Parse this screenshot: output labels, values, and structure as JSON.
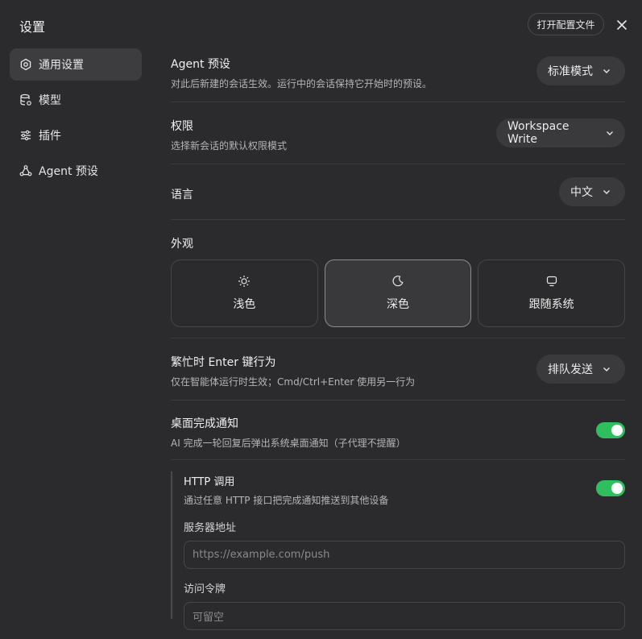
{
  "header": {
    "title": "设置",
    "open_config_label": "打开配置文件"
  },
  "sidebar": {
    "items": [
      {
        "label": "通用设置",
        "icon": "gear-icon",
        "active": true
      },
      {
        "label": "模型",
        "icon": "database-icon",
        "active": false
      },
      {
        "label": "插件",
        "icon": "sliders-icon",
        "active": false
      },
      {
        "label": "Agent 预设",
        "icon": "agent-preset-icon",
        "active": false
      }
    ]
  },
  "settings": {
    "agent_preset": {
      "label": "Agent 预设",
      "desc": "对此后新建的会话生效。运行中的会话保持它开始时的预设。",
      "value": "标准模式"
    },
    "permissions": {
      "label": "权限",
      "desc": "选择新会话的默认权限模式",
      "value": "Workspace Write"
    },
    "language": {
      "label": "语言",
      "value": "中文"
    },
    "appearance": {
      "label": "外观",
      "options": [
        {
          "label": "浅色",
          "icon": "sun-icon",
          "selected": false
        },
        {
          "label": "深色",
          "icon": "moon-icon",
          "selected": true
        },
        {
          "label": "跟随系统",
          "icon": "monitor-icon",
          "selected": false
        }
      ]
    },
    "busy_enter": {
      "label": "繁忙时 Enter 键行为",
      "desc": "仅在智能体运行时生效；Cmd/Ctrl+Enter 使用另一行为",
      "value": "排队发送"
    },
    "desktop_notify": {
      "label": "桌面完成通知",
      "desc": "AI 完成一轮回复后弹出系统桌面通知（子代理不提醒）",
      "enabled": true
    },
    "http_call": {
      "label": "HTTP 调用",
      "desc": "通过任意 HTTP 接口把完成通知推送到其他设备",
      "enabled": true,
      "server_label": "服务器地址",
      "server_placeholder": "https://example.com/push",
      "token_label": "访问令牌",
      "token_placeholder": "可留空"
    }
  },
  "colors": {
    "background": "#2b2b2d",
    "toggle_on": "#2fbf5f",
    "select_bg": "#3a3a3d"
  }
}
